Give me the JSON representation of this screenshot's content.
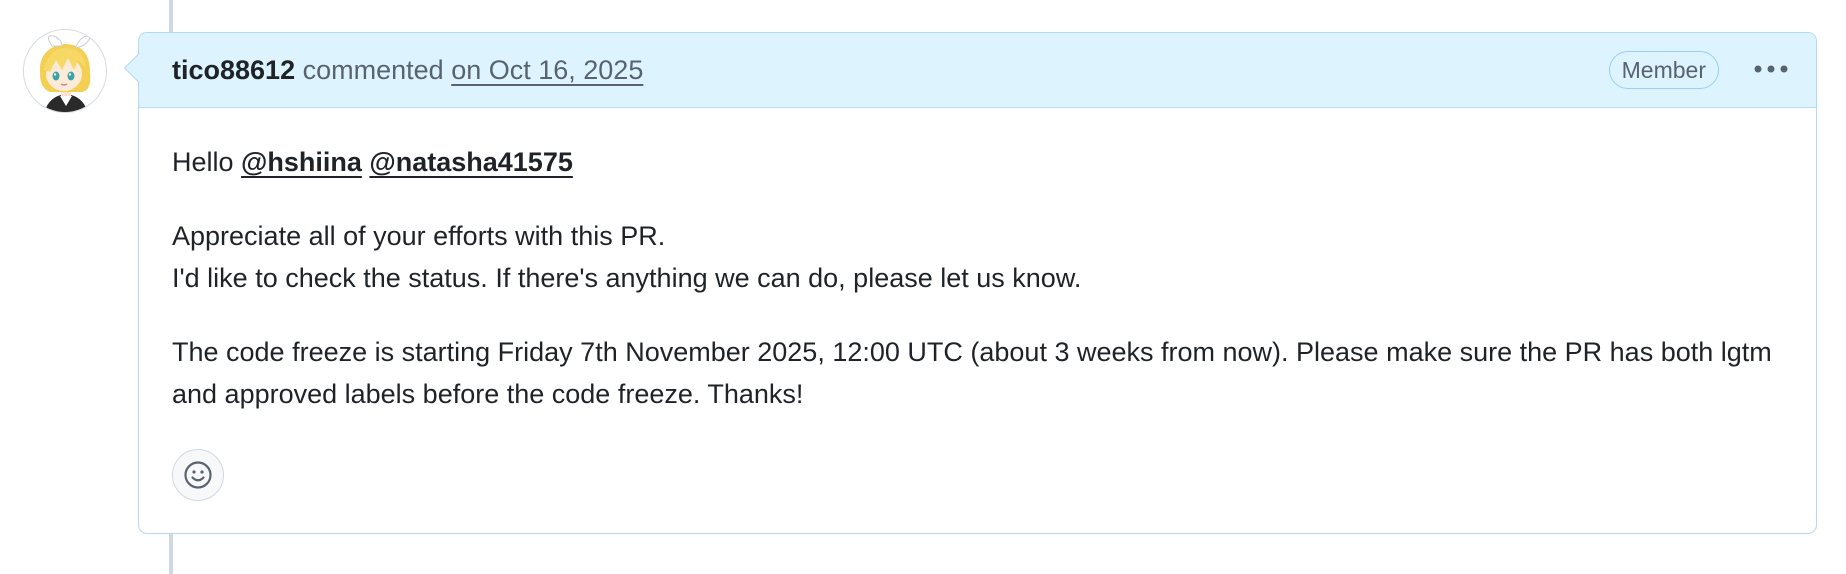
{
  "comment": {
    "author": "tico88612",
    "action": "commented",
    "date": "on Oct 16, 2025",
    "badge": "Member",
    "greeting": "Hello",
    "mentions": [
      "@hshiina",
      "@natasha41575"
    ],
    "line1": "Appreciate all of your efforts with this PR.",
    "line2": "I'd like to check the status. If there's anything we can do, please let us know.",
    "paragraph3": "The code freeze is starting Friday 7th November 2025, 12:00 UTC (about 3 weeks from now). Please make sure the PR has both lgtm and approved labels before the code freeze. Thanks!"
  },
  "icons": {
    "avatar": "anime-avatar",
    "more": "kebab-horizontal-icon",
    "reaction": "smiley-icon"
  },
  "colors": {
    "header_bg": "#ddf4ff",
    "border": "#b6d7f6",
    "text": "#1f2328",
    "muted": "#59636e"
  }
}
